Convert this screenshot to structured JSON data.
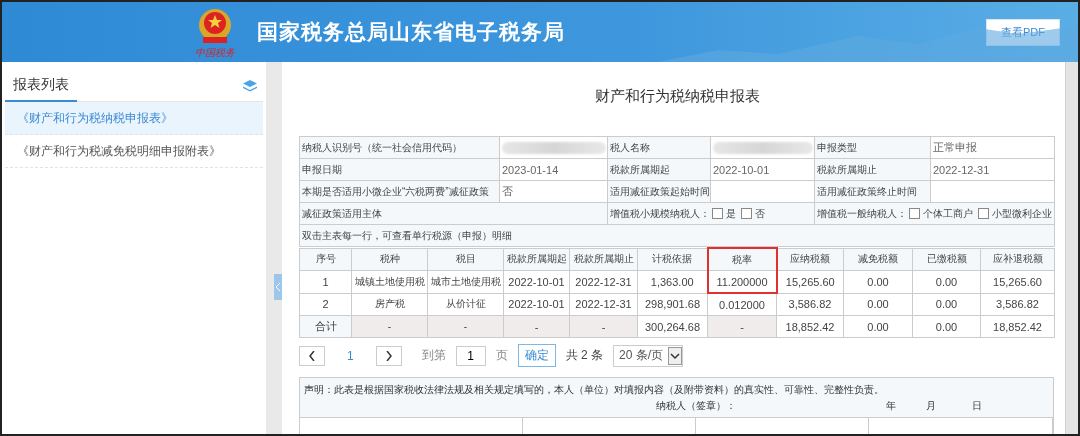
{
  "header": {
    "title": "国家税务总局山东省电子税务局",
    "emblem_caption": "中国税务",
    "pdf_button": "查看PDF"
  },
  "sidebar": {
    "title": "报表列表",
    "items": [
      {
        "label": "《财产和行为税纳税申报表》",
        "selected": true
      },
      {
        "label": "《财产和行为税减免税明细申报附表》",
        "selected": false
      }
    ]
  },
  "form": {
    "title": "财产和行为税纳税申报表",
    "info_rows": [
      [
        {
          "kind": "label",
          "text": "纳税人识别号（统一社会信用代码）"
        },
        {
          "kind": "redacted"
        },
        {
          "kind": "label",
          "text": "税人名称"
        },
        {
          "kind": "redacted"
        },
        {
          "kind": "label",
          "text": "申报类型"
        },
        {
          "kind": "value",
          "text": "正常申报"
        }
      ],
      [
        {
          "kind": "label",
          "text": "申报日期"
        },
        {
          "kind": "value",
          "text": "2023-01-14"
        },
        {
          "kind": "label",
          "text": "税款所属期起"
        },
        {
          "kind": "value",
          "text": "2022-10-01"
        },
        {
          "kind": "label",
          "text": "税款所属期止"
        },
        {
          "kind": "value",
          "text": "2022-12-31"
        }
      ],
      [
        {
          "kind": "label",
          "text": "本期是否适用小微企业“六税两费”减征政策"
        },
        {
          "kind": "value",
          "text": "否"
        },
        {
          "kind": "label",
          "text": "适用减征政策起始时间"
        },
        {
          "kind": "value"
        },
        {
          "kind": "label",
          "text": "适用减征政策终止时间"
        },
        {
          "kind": "value"
        }
      ],
      [
        {
          "kind": "label-wide",
          "text": "减征政策适用主体"
        },
        {
          "kind": "checks",
          "text": "增值税小规模纳税人：",
          "options": [
            {
              "label": "是",
              "checked": false
            },
            {
              "label": "否",
              "checked": false
            }
          ]
        },
        {
          "kind": "checks",
          "text": "增值税一般纳税人：",
          "options": [
            {
              "label": "个体工商户",
              "checked": false
            },
            {
              "label": "小型微利企业",
              "checked": false
            }
          ]
        }
      ]
    ],
    "notice": "双击主表每一行，可查看单行税源（申报）明细",
    "columns": [
      {
        "label": "序号",
        "highlighted": false
      },
      {
        "label": "税种",
        "highlighted": false
      },
      {
        "label": "税目",
        "highlighted": false
      },
      {
        "label": "税款所属期起",
        "highlighted": false
      },
      {
        "label": "税款所属期止",
        "highlighted": false
      },
      {
        "label": "计税依据",
        "highlighted": false
      },
      {
        "label": "税率",
        "highlighted": true
      },
      {
        "label": "应纳税额",
        "highlighted": false
      },
      {
        "label": "减免税额",
        "highlighted": false
      },
      {
        "label": "已缴税额",
        "highlighted": false
      },
      {
        "label": "应补退税额",
        "highlighted": false
      }
    ],
    "rows": [
      {
        "kind": "data",
        "highlighted": true,
        "cells": [
          {
            "text": "1",
            "shaded": false
          },
          {
            "text": "城镇土地使用税",
            "shaded": false
          },
          {
            "text": "城市土地使用税",
            "shaded": false
          },
          {
            "text": "2022-10-01",
            "shaded": false
          },
          {
            "text": "2022-12-31",
            "shaded": false
          },
          {
            "text": "1,363.00",
            "shaded": false
          },
          {
            "text": "11.200000",
            "shaded": false
          },
          {
            "text": "15,265.60",
            "shaded": false
          },
          {
            "text": "0.00",
            "shaded": false
          },
          {
            "text": "0.00",
            "shaded": false
          },
          {
            "text": "15,265.60",
            "shaded": false
          }
        ]
      },
      {
        "kind": "data",
        "highlighted": false,
        "cells": [
          {
            "text": "2",
            "shaded": false
          },
          {
            "text": "房产税",
            "shaded": false
          },
          {
            "text": "从价计征",
            "shaded": false
          },
          {
            "text": "2022-10-01",
            "shaded": false
          },
          {
            "text": "2022-12-31",
            "shaded": false
          },
          {
            "text": "298,901.68",
            "shaded": false
          },
          {
            "text": "0.012000",
            "shaded": false
          },
          {
            "text": "3,586.82",
            "shaded": false
          },
          {
            "text": "0.00",
            "shaded": false
          },
          {
            "text": "0.00",
            "shaded": false
          },
          {
            "text": "3,586.82",
            "shaded": false
          }
        ]
      },
      {
        "kind": "total",
        "highlighted": false,
        "cells": [
          {
            "text": "合计",
            "shaded": false
          },
          {
            "text": "-",
            "shaded": true
          },
          {
            "text": "-",
            "shaded": true
          },
          {
            "text": "-",
            "shaded": true
          },
          {
            "text": "-",
            "shaded": true
          },
          {
            "text": "300,264.68",
            "shaded": false
          },
          {
            "text": "-",
            "shaded": true
          },
          {
            "text": "18,852.42",
            "shaded": false
          },
          {
            "text": "0.00",
            "shaded": false
          },
          {
            "text": "0.00",
            "shaded": false
          },
          {
            "text": "18,852.42",
            "shaded": false
          }
        ]
      }
    ]
  },
  "pagination": {
    "page": "1",
    "goto_label": "到第",
    "goto_value": "1",
    "page_unit": "页",
    "confirm": "确定",
    "total": "共 2 条",
    "page_size": "20 条/页"
  },
  "declaration": {
    "text": "声明：此表是根据国家税收法律法规及相关规定填写的，本人（单位）对填报内容（及附带资料）的真实性、可靠性、完整性负责。",
    "signer": "纳税人（签章）：",
    "date_parts": [
      "年",
      "月",
      "日"
    ]
  }
}
